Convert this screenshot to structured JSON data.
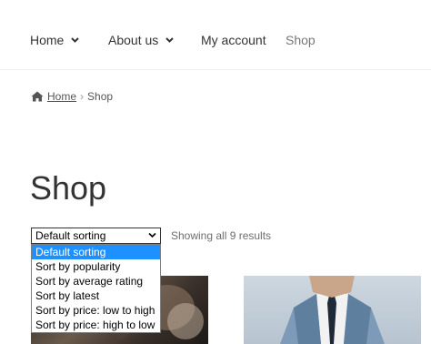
{
  "nav": {
    "items": [
      {
        "label": "Home",
        "has_dropdown": true
      },
      {
        "label": "About us",
        "has_dropdown": true
      },
      {
        "label": "My account",
        "has_dropdown": false
      },
      {
        "label": "Shop",
        "has_dropdown": false,
        "current": true
      }
    ]
  },
  "breadcrumb": {
    "home_icon": "home-icon",
    "home_label": "Home",
    "separator": "›",
    "current": "Shop"
  },
  "page": {
    "title": "Shop"
  },
  "sorting": {
    "selected": "Default sorting",
    "options": [
      "Default sorting",
      "Sort by popularity",
      "Sort by average rating",
      "Sort by latest",
      "Sort by price: low to high",
      "Sort by price: high to low"
    ],
    "result_count": "Showing all 9 results"
  },
  "colors": {
    "accent_selected": "#1e90ff",
    "text": "#333333",
    "muted": "#777777"
  }
}
